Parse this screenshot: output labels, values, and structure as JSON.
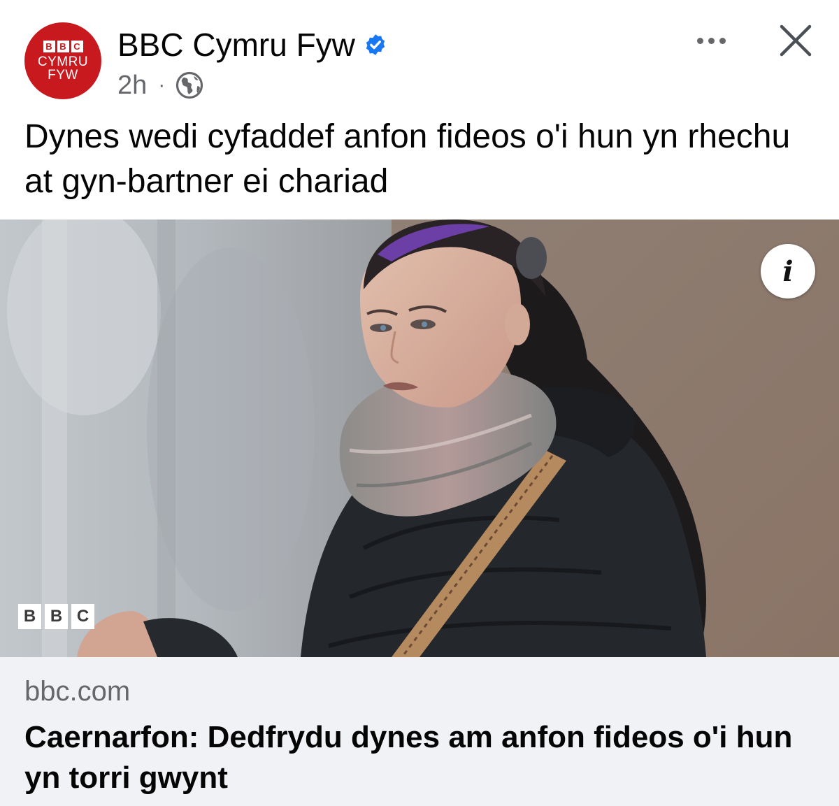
{
  "header": {
    "avatar": {
      "blocks": [
        "B",
        "B",
        "C"
      ],
      "line1": "CYMRU",
      "line2": "FYW"
    },
    "page_name": "BBC Cymru Fyw",
    "time": "2h",
    "separator": "·",
    "audience_icon": "globe-icon",
    "verified_icon": "verified-badge-icon"
  },
  "post": {
    "caption": "Dynes wedi cyfaddef anfon fideos o'i hun yn rhechu at gyn-bartner ei chariad"
  },
  "image": {
    "info_label": "i",
    "watermark": [
      "B",
      "B",
      "C"
    ]
  },
  "link": {
    "domain": "bbc.com",
    "title": "Caernarfon: Dedfrydu dynes am anfon fideos o'i hun yn torri gwynt"
  },
  "colors": {
    "brand_red": "#c8191f",
    "verified_blue": "#1877f2",
    "secondary_text": "#65676b",
    "link_background": "#f0f2f5"
  }
}
